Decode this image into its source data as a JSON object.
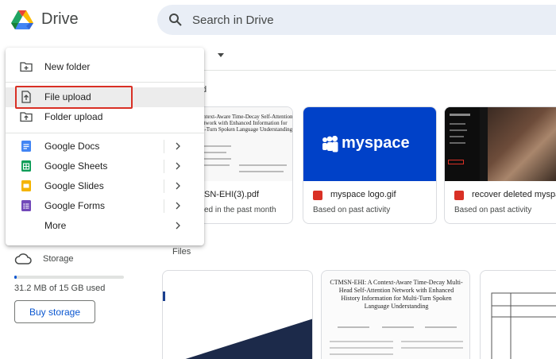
{
  "header": {
    "app_name": "Drive",
    "search_placeholder": "Search in Drive"
  },
  "main": {
    "title_partial": "ive",
    "suggested_partial": "d",
    "files_label": "Files",
    "suggested_cards": [
      {
        "title": "SN-EHI(3).pdf",
        "subtitle": "ed in the past month",
        "thumb_text": "A Context-Aware Time-Decay Self-Attention Network with Enhanced Information for Multi-Turn Spoken Language Understanding"
      },
      {
        "title": "myspace logo.gif",
        "subtitle": "Based on past activity",
        "thumb_text": "myspace"
      },
      {
        "title": "recover deleted myspa",
        "subtitle": "Based on past activity"
      }
    ],
    "file_cards": [
      {},
      {
        "thumb_text": "CTMSN-EHI: A Context-Aware Time-Decay Multi-Head Self-Attention Network with Enhanced History Information for Multi-Turn Spoken Language Understanding"
      },
      {}
    ]
  },
  "sidebar": {
    "storage_label": "Storage",
    "storage_used_text": "31.2 MB of 15 GB used",
    "storage_used_fraction": 0.02,
    "buy_storage_label": "Buy storage"
  },
  "menu": {
    "items": [
      {
        "label": "New folder",
        "icon": "new-folder-icon"
      },
      {
        "label": "File upload",
        "icon": "file-upload-icon"
      },
      {
        "label": "Folder upload",
        "icon": "folder-upload-icon"
      },
      {
        "label": "Google Docs",
        "icon": "google-docs-icon"
      },
      {
        "label": "Google Sheets",
        "icon": "google-sheets-icon"
      },
      {
        "label": "Google Slides",
        "icon": "google-slides-icon"
      },
      {
        "label": "Google Forms",
        "icon": "google-forms-icon"
      },
      {
        "label": "More",
        "icon": ""
      }
    ]
  },
  "colors": {
    "docs": "#4285f4",
    "sheets": "#0f9d58",
    "slides": "#f4b400",
    "forms": "#7248b9",
    "highlight": "#d93025",
    "accent": "#0b57d0"
  }
}
